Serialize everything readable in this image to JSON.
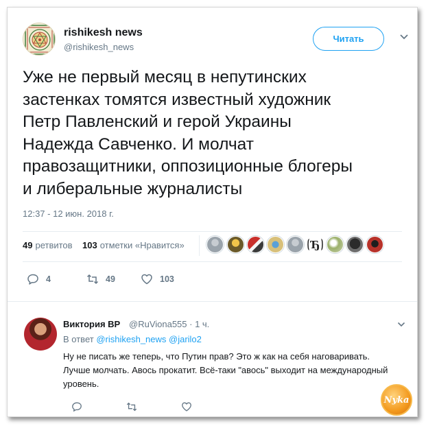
{
  "tweet": {
    "author_name": "rishikesh news",
    "author_handle": "@rishikesh_news",
    "follow_label": "Читать",
    "text": "Уже не первый месяц в непутинских\nзастенках томятся известный художник\nПетр Павленский и герой Украины\nНадежда Савченко. И молчат\nправозащитники, оппозиционные блогеры\nи либеральные журналисты",
    "timestamp": "12:37 - 12 июн. 2018 г.",
    "stats": {
      "retweets_count": "49",
      "retweets_label": "ретвитов",
      "likes_count": "103",
      "likes_label": "отметки «Нравится»"
    },
    "actions": {
      "reply_count": "4",
      "retweet_count": "49",
      "like_count": "103"
    }
  },
  "reply": {
    "author_name": "Виктория ВР",
    "meta": "@RuViona555 · 1 ч.",
    "reply_to_prefix": "В ответ",
    "reply_to_handles": "@rishikesh_news @jarilo2",
    "text": "Ну не писать же теперь, что Путин прав? Это ж как на себя наговаривать. Лучше молчать. Авось прокатит. Всё-таки \"авось\" выходит на международный уровень."
  },
  "watermark": {
    "text": "Nyka"
  },
  "colors": {
    "accent": "#1da1f2",
    "secondary_text": "#657786",
    "like_red": "#e0245e"
  },
  "icons": [
    "rishikesh-yantra-logo",
    "caret-down-icon",
    "reply-icon",
    "retweet-icon",
    "heart-icon"
  ]
}
